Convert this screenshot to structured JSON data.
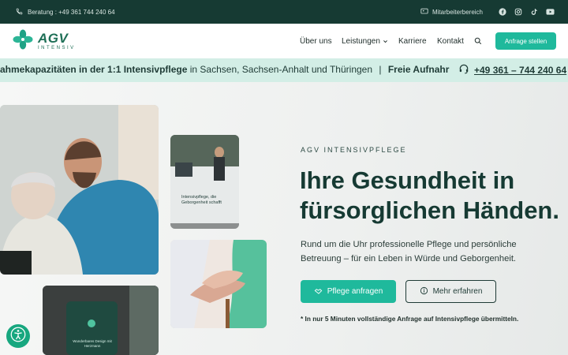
{
  "topbar": {
    "phone_text": "Beratung : +49 361 744 240 64",
    "staff_link": "Mitarbeiterbereich",
    "socials": [
      "facebook-icon",
      "instagram-icon",
      "tiktok-icon",
      "youtube-icon"
    ]
  },
  "nav": {
    "logo_main": "AGV",
    "logo_sub": "INTENSIV",
    "items": [
      "Über uns",
      "Leistungen",
      "Karriere",
      "Kontakt"
    ],
    "cta": "Anfrage stellen"
  },
  "ticker": {
    "bold_part": "ahmekapazitäten in der 1:1 Intensivpflege",
    "normal_part": " in Sachsen, Sachsen-Anhalt und Thüringen",
    "separator": "|",
    "bold_tail": "Freie Aufnahr",
    "phone": "+49 361 – 744 240 64"
  },
  "hero": {
    "eyebrow": "AGV INTENSIVPFLEGE",
    "heading_line1": "Ihre Gesundheit in",
    "heading_line2": "fürsorglichen Händen.",
    "lead": "Rund um die Uhr professionelle Pflege und persönliche Betreuung – für ein Leben in Würde und Geborgenheit.",
    "primary_button": "Pflege anfragen",
    "secondary_button": "Mehr erfahren",
    "note": "* In nur 5 Minuten vollständige Anfrage auf Intensivpflege übermitteln.",
    "van_text": "Intensivpflege, die Geborgenheit schafft",
    "phone_screen_text": "Wunderbares Design mit Herzmann"
  },
  "colors": {
    "dark_green": "#163a33",
    "accent": "#1fb99c",
    "ticker_bg": "#d3eee6"
  }
}
